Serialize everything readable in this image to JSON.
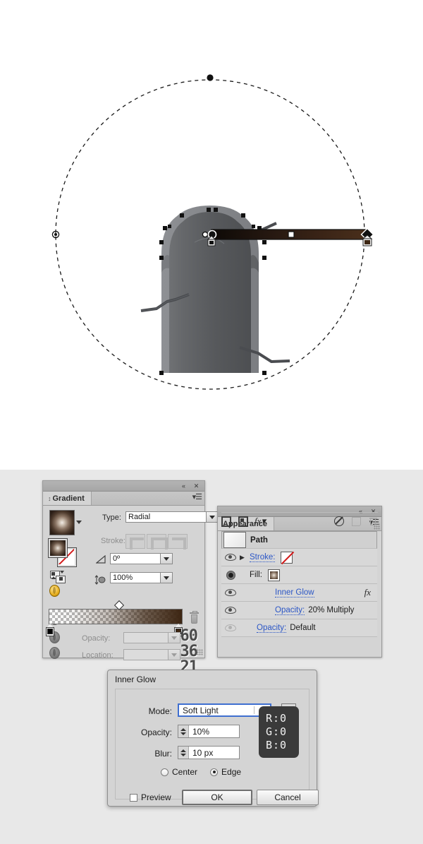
{
  "app": "Adobe Illustrator",
  "canvas": {
    "name": "artboard",
    "background": "#ffffff",
    "artwork_description": "tombstone-with-radial-gradient",
    "gradient_annotator": {
      "start_color": "#000000",
      "end_color": "#3d2613",
      "midpoint_marker": "diamond",
      "radial_circle": "dashed"
    }
  },
  "gradient_panel": {
    "tab_label": "Gradient",
    "collapse_icon": "«",
    "close_icon": "✕",
    "menu_icon": "panel-menu-icon",
    "type_label": "Type:",
    "type_value": "Radial",
    "stroke_label": "Stroke:",
    "angle_label": "angle-icon",
    "angle_value": "0º",
    "aspect_label": "aspect-ratio-icon",
    "aspect_value": "100%",
    "opacity_label": "Opacity:",
    "opacity_value": "",
    "location_label": "Location:",
    "location_value": "",
    "ghost_numbers": [
      "60",
      "36",
      "21"
    ],
    "stops": [
      {
        "position": 0,
        "color": "#000000",
        "opacity": 0
      },
      {
        "position": 100,
        "color": "#3d2613",
        "opacity": 100
      }
    ],
    "midpoint": 50
  },
  "appearance_panel": {
    "tab_label": "Appearance",
    "collapse_icon": "«",
    "close_icon": "✕",
    "menu_icon": "panel-menu-icon",
    "rows": [
      {
        "type": "header",
        "label": "Path",
        "thumb": "path-thumbnail"
      },
      {
        "type": "stroke",
        "label": "Stroke:",
        "swatch": "none",
        "visible": true,
        "expandable": true
      },
      {
        "type": "fill",
        "label": "Fill:",
        "swatch": "radial-gradient",
        "visible": true,
        "selected": true
      },
      {
        "type": "effect",
        "label": "Inner Glow",
        "fx": "fx",
        "visible": true
      },
      {
        "type": "opacity",
        "label": "Opacity:",
        "value": "20% Multiply",
        "visible": true
      },
      {
        "type": "opacity",
        "label": "Opacity:",
        "value": "Default",
        "visible": false
      }
    ],
    "footer_icons": [
      "add-new-stroke-icon",
      "add-new-fill-icon",
      "add-new-effect-icon",
      "clear-appearance-icon",
      "duplicate-item-icon",
      "delete-item-icon"
    ]
  },
  "inner_glow_dialog": {
    "title": "Inner Glow",
    "mode_label": "Mode:",
    "mode_value": "Soft Light",
    "color_swatch": "#000000",
    "opacity_label": "Opacity:",
    "opacity_value": "10%",
    "blur_label": "Blur:",
    "blur_value": "10 px",
    "center_label": "Center",
    "edge_label": "Edge",
    "selected_origin": "Edge",
    "preview_label": "Preview",
    "preview_checked": false,
    "ok_label": "OK",
    "cancel_label": "Cancel"
  },
  "color_readout": {
    "r": "R:0",
    "g": "G:0",
    "b": "B:0"
  }
}
